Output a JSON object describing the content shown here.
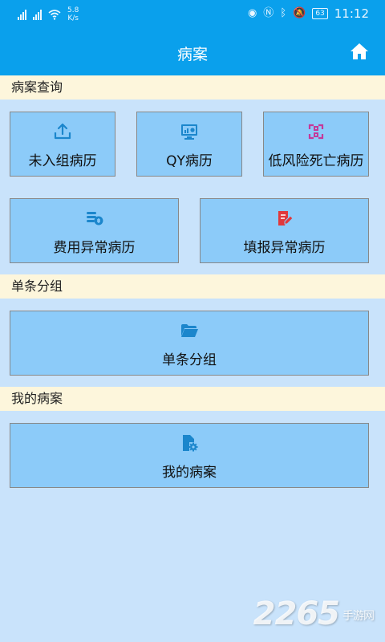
{
  "status_bar": {
    "net_speed_value": "5.8",
    "net_speed_unit": "K/s",
    "battery": "63",
    "time": "11:12"
  },
  "app_bar": {
    "title": "病案"
  },
  "sections": {
    "query": {
      "header": "病案查询",
      "items": [
        {
          "label": "未入组病历",
          "icon": "upload-icon"
        },
        {
          "label": "QY病历",
          "icon": "monitor-chart-icon"
        },
        {
          "label": "低风险死亡病历",
          "icon": "scan-frame-icon"
        },
        {
          "label": "费用异常病历",
          "icon": "coins-icon"
        },
        {
          "label": "填报异常病历",
          "icon": "edit-document-icon"
        }
      ]
    },
    "group": {
      "header": "单条分组",
      "items": [
        {
          "label": "单条分组",
          "icon": "folder-icon"
        }
      ]
    },
    "mine": {
      "header": "我的病案",
      "items": [
        {
          "label": "我的病案",
          "icon": "file-gear-icon"
        }
      ]
    }
  },
  "watermark": {
    "number": "2265",
    "suffix": "手游网"
  },
  "colors": {
    "primary": "#0aa0ec",
    "page_bg": "#c9e3fb",
    "section_header_bg": "#fdf6dc",
    "card_bg": "#8ccbf9",
    "icon_blue": "#1b86cc",
    "icon_magenta": "#c43a9a",
    "icon_red": "#e0383c"
  }
}
